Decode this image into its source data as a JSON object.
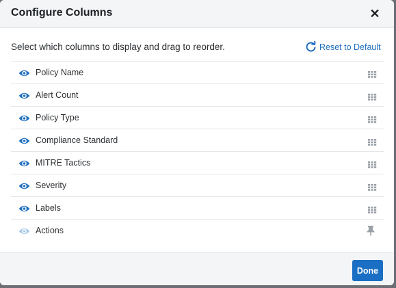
{
  "dialog": {
    "title": "Configure Columns",
    "close_icon": "close-icon",
    "instruction": "Select which columns to display and drag to reorder.",
    "reset_label": "Reset to Default",
    "done_label": "Done"
  },
  "columns": [
    {
      "label": "Policy Name",
      "visible": true,
      "handle": "drag-handle-icon"
    },
    {
      "label": "Alert Count",
      "visible": true,
      "handle": "drag-handle-icon"
    },
    {
      "label": "Policy Type",
      "visible": true,
      "handle": "drag-handle-icon"
    },
    {
      "label": "Compliance Standard",
      "visible": true,
      "handle": "drag-handle-icon"
    },
    {
      "label": "MITRE Tactics",
      "visible": true,
      "handle": "drag-handle-icon"
    },
    {
      "label": "Severity",
      "visible": true,
      "handle": "drag-handle-icon"
    },
    {
      "label": "Labels",
      "visible": true,
      "handle": "drag-handle-icon"
    },
    {
      "label": "Actions",
      "visible": false,
      "handle": "pin-icon"
    }
  ],
  "colors": {
    "accent": "#1a6fc4",
    "eye_active": "#1f6fc0",
    "eye_inactive": "#a9cbe8",
    "handle": "#9aa0a6"
  }
}
